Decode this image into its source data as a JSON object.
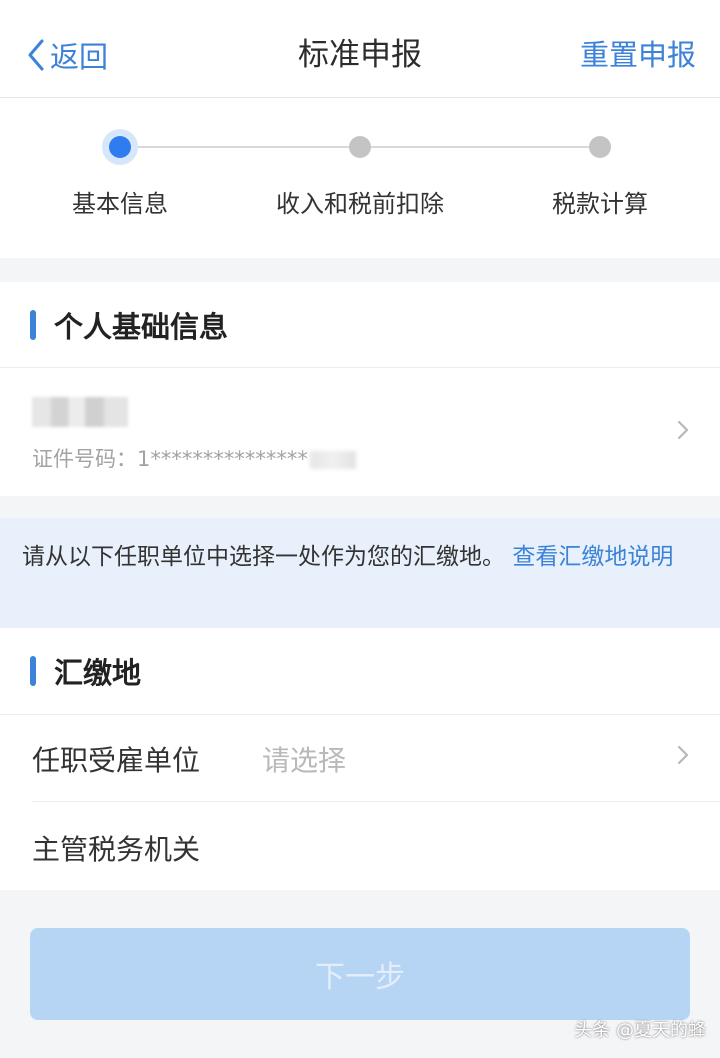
{
  "navbar": {
    "back_label": "返回",
    "title": "标准申报",
    "right_action": "重置申报"
  },
  "steps": [
    {
      "label": "基本信息",
      "state": "active"
    },
    {
      "label": "收入和税前扣除",
      "state": "pending"
    },
    {
      "label": "税款计算",
      "state": "pending"
    }
  ],
  "personal_info": {
    "section_title": "个人基础信息",
    "id_prefix": "证件号码：",
    "id_masked": "1***************"
  },
  "notice": {
    "text": "请从以下任职单位中选择一处作为您的汇缴地。",
    "link": "查看汇缴地说明"
  },
  "payment_location": {
    "section_title": "汇缴地",
    "employer_label": "任职受雇单位",
    "employer_placeholder": "请选择",
    "tax_authority_label": "主管税务机关"
  },
  "next_button": "下一步",
  "watermark": "头条 @夏天的蜂",
  "colors": {
    "accent": "#3b82d8",
    "step_active": "#2f7cf0",
    "button_disabled": "#b6d4f4",
    "notice_bg": "#e8f1fb"
  }
}
